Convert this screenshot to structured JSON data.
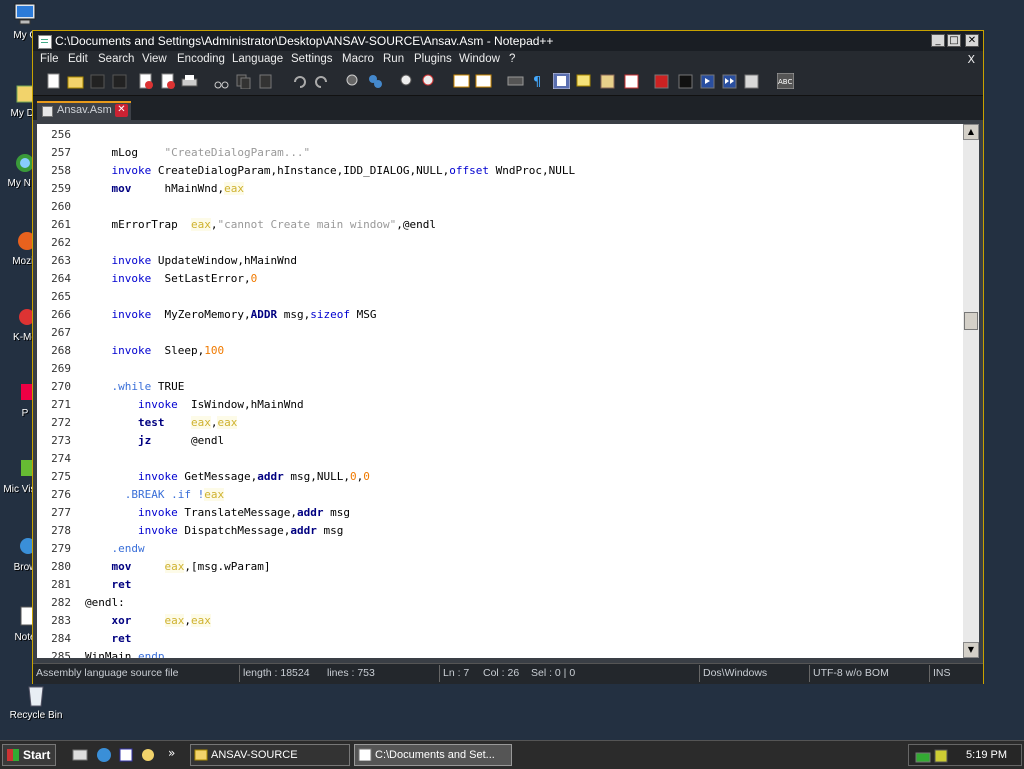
{
  "desktop": {
    "icons": [
      {
        "label": "My C"
      },
      {
        "label": "My Do"
      },
      {
        "label": "My N Pl"
      },
      {
        "label": "Mozill"
      },
      {
        "label": "K-Me"
      },
      {
        "label": "P"
      },
      {
        "label": "Mic Visua"
      },
      {
        "label": "Brow"
      },
      {
        "label": "Note"
      },
      {
        "label": "Recycle Bin"
      }
    ]
  },
  "window": {
    "title": "C:\\Documents and Settings\\Administrator\\Desktop\\ANSAV-SOURCE\\Ansav.Asm - Notepad++",
    "minimize": "_",
    "maximize": "□",
    "close": "✕"
  },
  "menu": {
    "items": [
      "File",
      "Edit",
      "Search",
      "View",
      "Encoding",
      "Language",
      "Settings",
      "Macro",
      "Run",
      "Plugins",
      "Window",
      "?"
    ],
    "close_doc": "X"
  },
  "tab": {
    "label": "Ansav.Asm",
    "close": "✕"
  },
  "editor": {
    "lines": [
      {
        "n": "256",
        "code": ""
      },
      {
        "n": "257",
        "code": "    mLog    \"CreateDialogParam...\""
      },
      {
        "n": "258",
        "code": "    invoke CreateDialogParam,hInstance,IDD_DIALOG,NULL,offset WndProc,NULL"
      },
      {
        "n": "259",
        "code": "    mov     hMainWnd,eax"
      },
      {
        "n": "260",
        "code": ""
      },
      {
        "n": "261",
        "code": "    mErrorTrap  eax,\"cannot Create main window\",@endl"
      },
      {
        "n": "262",
        "code": ""
      },
      {
        "n": "263",
        "code": "    invoke UpdateWindow,hMainWnd"
      },
      {
        "n": "264",
        "code": "    invoke  SetLastError,0"
      },
      {
        "n": "265",
        "code": ""
      },
      {
        "n": "266",
        "code": "    invoke  MyZeroMemory,ADDR msg,sizeof MSG"
      },
      {
        "n": "267",
        "code": ""
      },
      {
        "n": "268",
        "code": "    invoke  Sleep,100"
      },
      {
        "n": "269",
        "code": ""
      },
      {
        "n": "270",
        "code": "    .while TRUE"
      },
      {
        "n": "271",
        "code": "        invoke  IsWindow,hMainWnd"
      },
      {
        "n": "272",
        "code": "        test    eax,eax"
      },
      {
        "n": "273",
        "code": "        jz      @endl"
      },
      {
        "n": "274",
        "code": ""
      },
      {
        "n": "275",
        "code": "        invoke GetMessage,addr msg,NULL,0,0"
      },
      {
        "n": "276",
        "code": "      .BREAK .if !eax"
      },
      {
        "n": "277",
        "code": "        invoke TranslateMessage,addr msg"
      },
      {
        "n": "278",
        "code": "        invoke DispatchMessage,addr msg"
      },
      {
        "n": "279",
        "code": "    .endw"
      },
      {
        "n": "280",
        "code": "    mov     eax,[msg.wParam]"
      },
      {
        "n": "281",
        "code": "    ret"
      },
      {
        "n": "282",
        "code": "@endl:"
      },
      {
        "n": "283",
        "code": "    xor     eax,eax"
      },
      {
        "n": "284",
        "code": "    ret"
      },
      {
        "n": "285",
        "code": "WinMain endp"
      }
    ]
  },
  "status": {
    "type": "Assembly language source file",
    "length": "length : 18524",
    "lines": "lines : 753",
    "ln": "Ln : 7",
    "col": "Col : 26",
    "sel": "Sel : 0 | 0",
    "eol": "Dos\\Windows",
    "encoding": "UTF-8 w/o BOM",
    "mode": "INS"
  },
  "taskbar": {
    "start": "Start",
    "chevron": "»",
    "tasks": [
      {
        "label": "ANSAV-SOURCE"
      },
      {
        "label": "C:\\Documents and Set..."
      }
    ],
    "clock": "5:19 PM"
  },
  "colors": {
    "keyword": "#0000d0",
    "instruction": "#000080",
    "register": "#cfb230",
    "number": "#f07a00",
    "string": "#999999",
    "tab_accent": "#e89a1a"
  }
}
